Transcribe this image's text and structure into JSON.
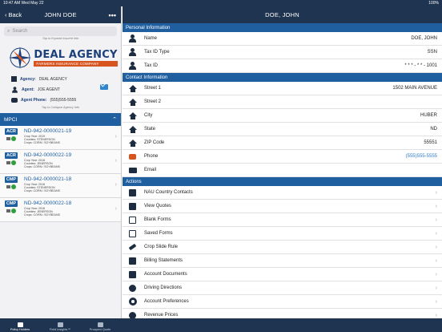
{
  "status": {
    "time": "10:47 AM",
    "date": "Wed May 22",
    "battery": "100%"
  },
  "left_nav": {
    "back_label": "Back",
    "title": "JOHN DOE",
    "more": "•••"
  },
  "right_nav": {
    "title": "DOE, JOHN"
  },
  "search": {
    "placeholder": "Search"
  },
  "hints": {
    "expand": "Tap to Expand Insured Info",
    "collapse": "Tap to Collapse Agency Info"
  },
  "logo": {
    "name": "DEAL AGENCY",
    "sub": "FARMERS INSURANCE COMPANY"
  },
  "agency": {
    "agency_label": "Agency:",
    "agency_value": "DEAL AGENCY",
    "agent_label": "Agent:",
    "agent_value": "JOE AGENT",
    "phone_label": "Agent Phone:",
    "phone_value": "(555)555-5555"
  },
  "mpci": {
    "label": "MPCI"
  },
  "policies": [
    {
      "badge": "ACR",
      "number": "ND-942-0000021-19",
      "year": "Crop Year: 2019",
      "counties": "Counties: STENERSON",
      "crops": "Crops: CORN / SOYBEANS"
    },
    {
      "badge": "ACR",
      "number": "ND-942-0000022-19",
      "year": "Crop Year: 2018",
      "counties": "Counties: JENERSON",
      "crops": "Crops: CORN / SOYBEANS"
    },
    {
      "badge": "CMP",
      "number": "ND-942-0000021-18",
      "year": "Crop Year: 2018",
      "counties": "Counties: STENERSON",
      "crops": "Crops: CORN / SOYBEANS"
    },
    {
      "badge": "CMP",
      "number": "ND-942-0000022-18",
      "year": "Crop Year: 2018",
      "counties": "Counties: JENERSON",
      "crops": "Crops: CORN / SOYBEANS"
    }
  ],
  "tabs": [
    {
      "label": "Policy Holders",
      "icon": "people-icon"
    },
    {
      "label": "Field Insights™",
      "icon": "field-icon"
    },
    {
      "label": "Prospect Quote",
      "icon": "quote-icon"
    }
  ],
  "personal": {
    "header": "Personal Information",
    "rows": [
      {
        "label": "Name",
        "value": "DOE, JOHN"
      },
      {
        "label": "Tax ID Type",
        "value": "SSN"
      },
      {
        "label": "Tax ID",
        "value": "* * * - * * - 1001"
      }
    ]
  },
  "contact": {
    "header": "Contact Information",
    "rows": [
      {
        "label": "Street 1",
        "value": "1502 MAIN AVENUE",
        "icon": "house"
      },
      {
        "label": "Street 2",
        "value": "",
        "icon": "house"
      },
      {
        "label": "City",
        "value": "HUBER",
        "icon": "house"
      },
      {
        "label": "State",
        "value": "ND",
        "icon": "house"
      },
      {
        "label": "ZIP Code",
        "value": "55551",
        "icon": "house"
      },
      {
        "label": "Phone",
        "value": "(555)555-5555",
        "icon": "phone"
      },
      {
        "label": "Email",
        "value": "",
        "icon": "env"
      }
    ]
  },
  "actions": {
    "header": "Actions",
    "items": [
      {
        "label": "NAU Country Contacts"
      },
      {
        "label": "View Quotes"
      },
      {
        "label": "Blank Forms"
      },
      {
        "label": "Saved Forms"
      },
      {
        "label": "Crop Slide Rule"
      },
      {
        "label": "Billing Statements"
      },
      {
        "label": "Account Documents"
      },
      {
        "label": "Driving Directions"
      },
      {
        "label": "Account Preferences"
      },
      {
        "label": "Revenue Prices"
      }
    ]
  }
}
